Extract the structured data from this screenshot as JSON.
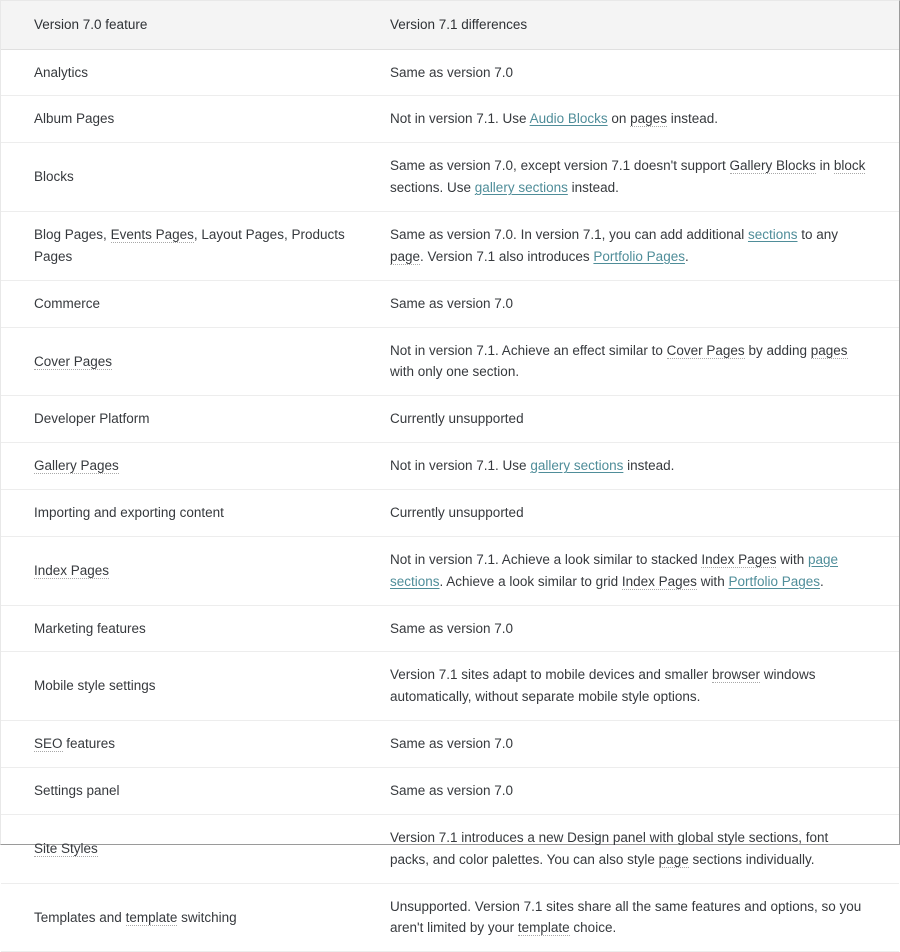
{
  "table": {
    "headers": {
      "col1": "Version 7.0 feature",
      "col2": "Version 7.1 differences"
    },
    "rows": [
      {
        "feature_parts": [
          {
            "text": "Analytics",
            "style": "plain"
          }
        ],
        "difference_parts": [
          {
            "text": "Same as version 7.0",
            "style": "plain"
          }
        ]
      },
      {
        "feature_parts": [
          {
            "text": "Album Pages",
            "style": "plain"
          }
        ],
        "difference_parts": [
          {
            "text": "Not in version 7.1. Use ",
            "style": "plain"
          },
          {
            "text": "Audio Blocks",
            "style": "link"
          },
          {
            "text": " on ",
            "style": "plain"
          },
          {
            "text": "pages",
            "style": "dotted"
          },
          {
            "text": " instead.",
            "style": "plain"
          }
        ]
      },
      {
        "feature_parts": [
          {
            "text": "Blocks",
            "style": "plain"
          }
        ],
        "difference_parts": [
          {
            "text": "Same as version 7.0, except version 7.1 doesn't support ",
            "style": "plain"
          },
          {
            "text": "Gallery Blocks",
            "style": "dotted"
          },
          {
            "text": " in ",
            "style": "plain"
          },
          {
            "text": "block",
            "style": "dotted"
          },
          {
            "text": " sections. Use ",
            "style": "plain"
          },
          {
            "text": "gallery sections",
            "style": "link"
          },
          {
            "text": " instead.",
            "style": "plain"
          }
        ]
      },
      {
        "feature_parts": [
          {
            "text": "Blog Pages, ",
            "style": "plain"
          },
          {
            "text": "Events Pages",
            "style": "dotted"
          },
          {
            "text": ", Layout Pages, Products Pages",
            "style": "plain"
          }
        ],
        "difference_parts": [
          {
            "text": "Same as version 7.0. In version 7.1, you can add additional ",
            "style": "plain"
          },
          {
            "text": "sections",
            "style": "link"
          },
          {
            "text": " to any ",
            "style": "plain"
          },
          {
            "text": "page",
            "style": "dotted"
          },
          {
            "text": ". Version 7.1 also introduces ",
            "style": "plain"
          },
          {
            "text": "Portfolio Pages",
            "style": "link"
          },
          {
            "text": ".",
            "style": "plain"
          }
        ]
      },
      {
        "feature_parts": [
          {
            "text": "Commerce",
            "style": "plain"
          }
        ],
        "difference_parts": [
          {
            "text": "Same as version 7.0",
            "style": "plain"
          }
        ]
      },
      {
        "feature_parts": [
          {
            "text": "Cover Pages",
            "style": "dotted"
          }
        ],
        "difference_parts": [
          {
            "text": "Not in version 7.1. Achieve an effect similar to ",
            "style": "plain"
          },
          {
            "text": "Cover Pages",
            "style": "dotted"
          },
          {
            "text": " by adding ",
            "style": "plain"
          },
          {
            "text": "pages",
            "style": "dotted"
          },
          {
            "text": " with only one section.",
            "style": "plain"
          }
        ]
      },
      {
        "feature_parts": [
          {
            "text": "Developer Platform",
            "style": "plain"
          }
        ],
        "difference_parts": [
          {
            "text": "Currently unsupported",
            "style": "plain"
          }
        ]
      },
      {
        "feature_parts": [
          {
            "text": "Gallery Pages",
            "style": "dotted"
          }
        ],
        "difference_parts": [
          {
            "text": "Not in version 7.1. Use ",
            "style": "plain"
          },
          {
            "text": "gallery sections",
            "style": "link"
          },
          {
            "text": " instead.",
            "style": "plain"
          }
        ]
      },
      {
        "feature_parts": [
          {
            "text": "Importing and exporting content",
            "style": "plain"
          }
        ],
        "difference_parts": [
          {
            "text": "Currently unsupported",
            "style": "plain"
          }
        ]
      },
      {
        "feature_parts": [
          {
            "text": "Index Pages",
            "style": "dotted"
          }
        ],
        "difference_parts": [
          {
            "text": "Not in version 7.1. Achieve a look similar to stacked ",
            "style": "plain"
          },
          {
            "text": "Index Pages",
            "style": "dotted"
          },
          {
            "text": " with ",
            "style": "plain"
          },
          {
            "text": "page sections",
            "style": "link"
          },
          {
            "text": ". Achieve a look similar to grid ",
            "style": "plain"
          },
          {
            "text": "Index Pages",
            "style": "dotted"
          },
          {
            "text": " with ",
            "style": "plain"
          },
          {
            "text": "Portfolio Pages",
            "style": "link"
          },
          {
            "text": ".",
            "style": "plain"
          }
        ]
      },
      {
        "feature_parts": [
          {
            "text": "Marketing features",
            "style": "plain"
          }
        ],
        "difference_parts": [
          {
            "text": "Same as version 7.0",
            "style": "plain"
          }
        ]
      },
      {
        "feature_parts": [
          {
            "text": "Mobile style settings",
            "style": "plain"
          }
        ],
        "difference_parts": [
          {
            "text": "Version 7.1 sites adapt to mobile devices and smaller ",
            "style": "plain"
          },
          {
            "text": "browser",
            "style": "dotted"
          },
          {
            "text": " windows automatically, without separate mobile style options.",
            "style": "plain"
          }
        ]
      },
      {
        "feature_parts": [
          {
            "text": "SEO",
            "style": "dotted"
          },
          {
            "text": " features",
            "style": "plain"
          }
        ],
        "difference_parts": [
          {
            "text": "Same as version 7.0",
            "style": "plain"
          }
        ]
      },
      {
        "feature_parts": [
          {
            "text": "Settings panel",
            "style": "plain"
          }
        ],
        "difference_parts": [
          {
            "text": "Same as version 7.0",
            "style": "plain"
          }
        ]
      },
      {
        "feature_parts": [
          {
            "text": "Site Styles",
            "style": "dotted"
          }
        ],
        "difference_parts": [
          {
            "text": "Version 7.1 introduces a new Design panel with global style sections, font packs, and color palettes. You can also style ",
            "style": "plain"
          },
          {
            "text": "page",
            "style": "dotted"
          },
          {
            "text": " sections individually.",
            "style": "plain"
          }
        ]
      },
      {
        "feature_parts": [
          {
            "text": "Templates and ",
            "style": "plain"
          },
          {
            "text": "template",
            "style": "dotted"
          },
          {
            "text": " switching",
            "style": "plain"
          }
        ],
        "difference_parts": [
          {
            "text": "Unsupported. Version 7.1 sites share all the same features and options, so you aren't limited by your ",
            "style": "plain"
          },
          {
            "text": "template",
            "style": "dotted"
          },
          {
            "text": " choice.",
            "style": "plain"
          }
        ]
      }
    ]
  },
  "colors": {
    "header_background": "#f4f4f4",
    "text": "#36393d",
    "link": "#4f8d99",
    "row_border": "#ededed",
    "dotted_underline": "#a8a8a8"
  }
}
